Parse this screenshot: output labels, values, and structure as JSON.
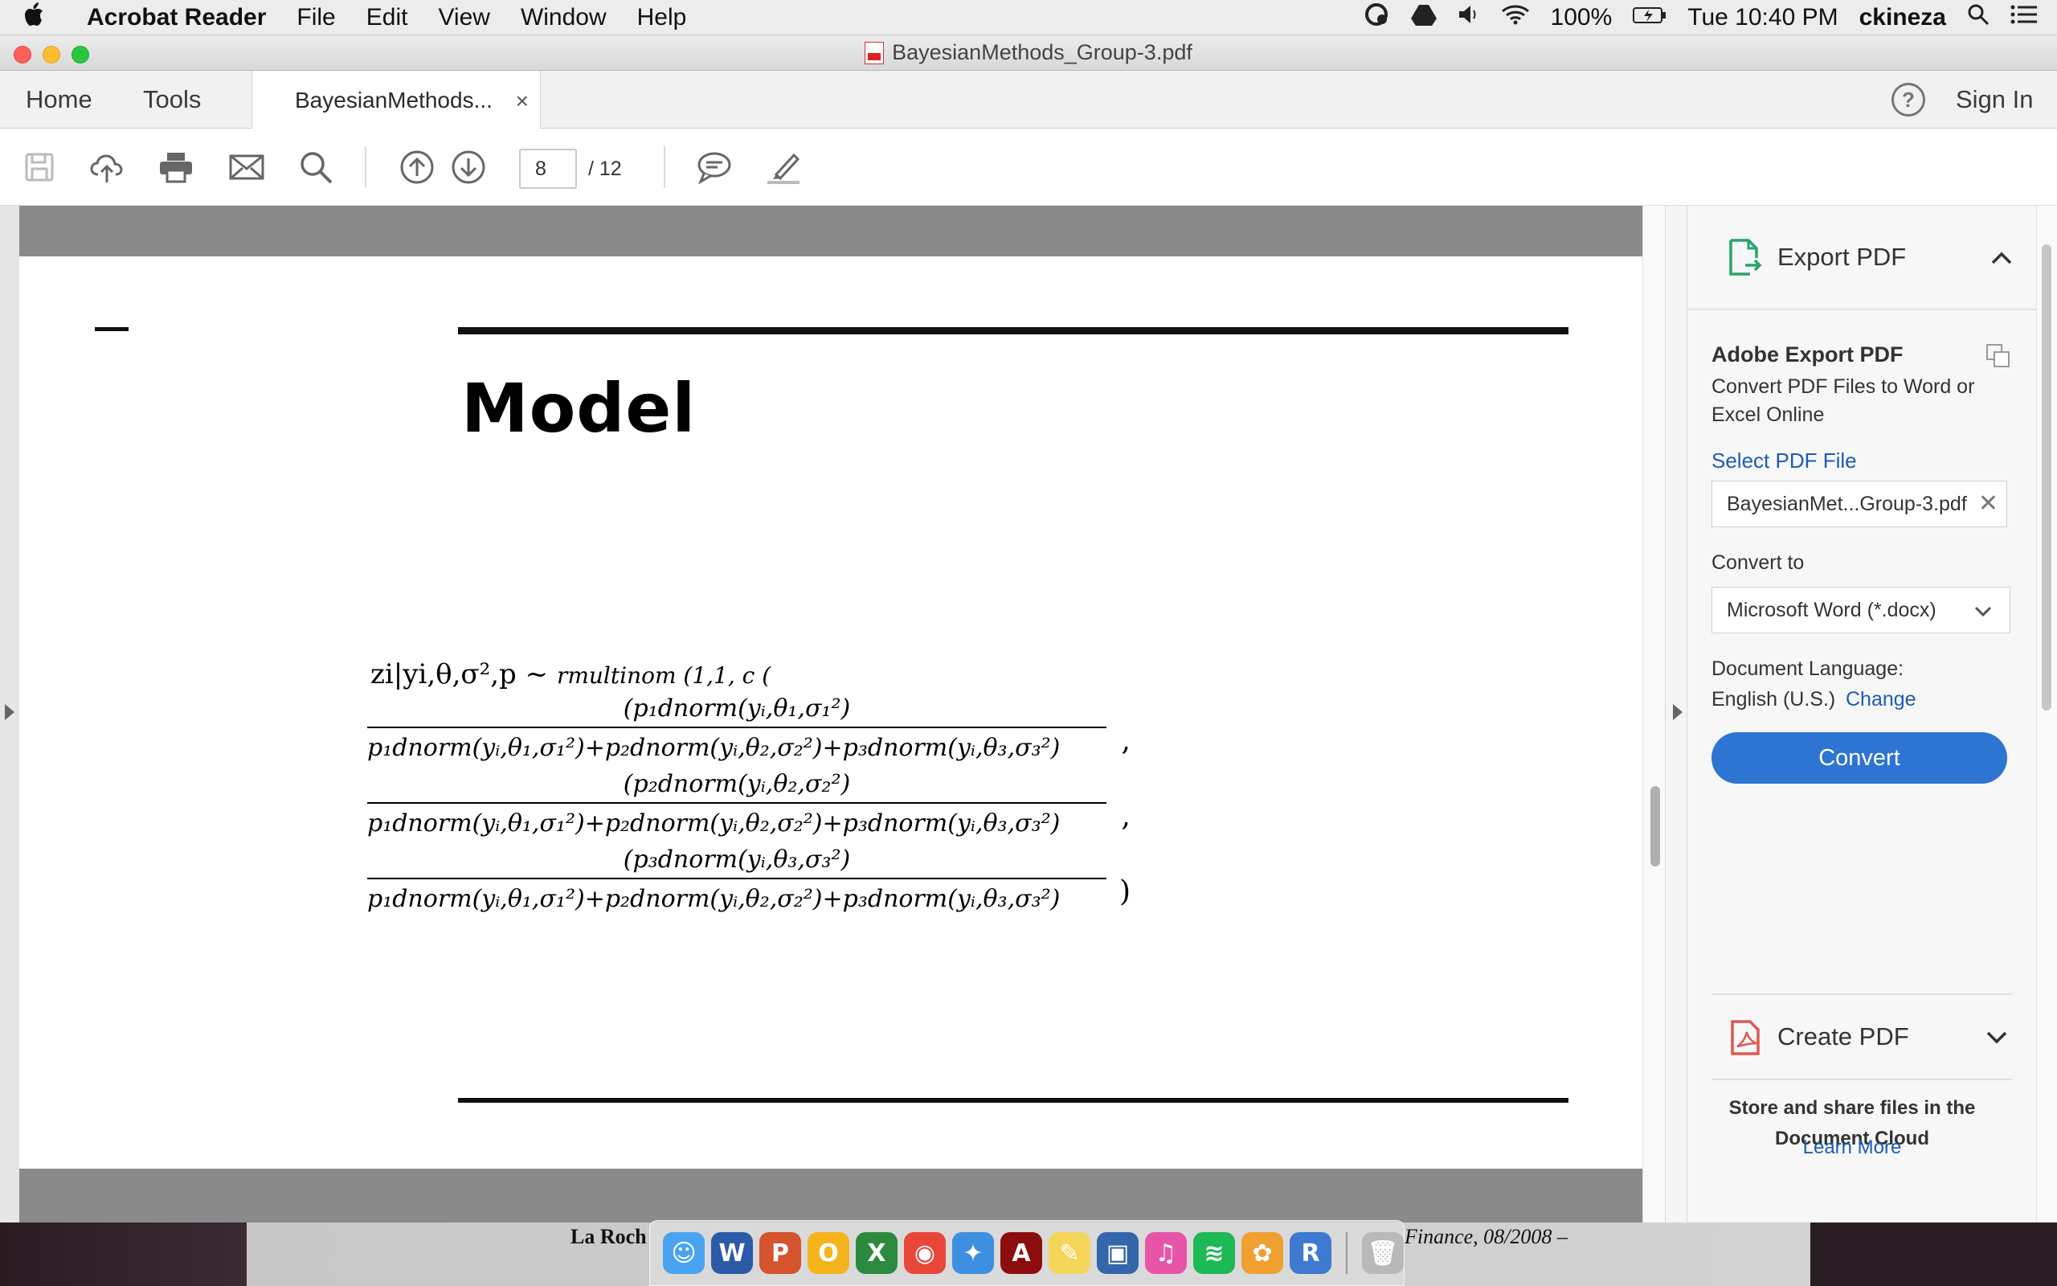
{
  "menubar": {
    "app_name": "Acrobat Reader",
    "menus": [
      "File",
      "Edit",
      "View",
      "Window",
      "Help"
    ],
    "battery": "100%",
    "clock": "Tue 10:40 PM",
    "user": "ckineza"
  },
  "window": {
    "title": "BayesianMethods_Group-3.pdf"
  },
  "tabs": {
    "home": "Home",
    "tools": "Tools",
    "document": "BayesianMethods...",
    "close": "×",
    "help": "?",
    "sign_in": "Sign In"
  },
  "toolbar": {
    "current_page": "8",
    "total_pages": "/  12",
    "icons": [
      "save-icon",
      "upload-cloud-icon",
      "print-icon",
      "mail-icon",
      "search-icon",
      "page-up-icon",
      "page-down-icon",
      "comment-icon",
      "highlight-pen-icon"
    ]
  },
  "document": {
    "page_title": "Model",
    "equation": {
      "head": "zi|yi,θ,σ²,p ~",
      "head_small": "rmultinom (1,1, c (",
      "fractions": [
        {
          "num": "(p₁dnorm(yᵢ,θ₁,σ₁²)",
          "den": "p₁dnorm(yᵢ,θ₁,σ₁²)+p₂dnorm(yᵢ,θ₂,σ₂²)+p₃dnorm(yᵢ,θ₃,σ₃²)",
          "tail": ","
        },
        {
          "num": "(p₂dnorm(yᵢ,θ₂,σ₂²)",
          "den": "p₁dnorm(yᵢ,θ₁,σ₁²)+p₂dnorm(yᵢ,θ₂,σ₂²)+p₃dnorm(yᵢ,θ₃,σ₃²)",
          "tail": ","
        },
        {
          "num": "(p₃dnorm(yᵢ,θ₃,σ₃²)",
          "den": "p₁dnorm(yᵢ,θ₁,σ₁²)+p₂dnorm(yᵢ,θ₂,σ₂²)+p₃dnorm(yᵢ,θ₃,σ₃²)",
          "tail": ")"
        }
      ]
    }
  },
  "panel": {
    "export_header": "Export PDF",
    "export_title": "Adobe Export PDF",
    "export_desc": "Convert PDF Files to Word or Excel Online",
    "select_link": "Select PDF File",
    "file_name": "BayesianMet...Group-3.pdf",
    "convert_to_label": "Convert to",
    "format": "Microsoft Word (*.docx)",
    "lang_label": "Document Language:",
    "lang_value": "English (U.S.)",
    "lang_change": "Change",
    "convert_button": "Convert",
    "create_header": "Create PDF",
    "cloud_text": "Store and share files in the Document Cloud",
    "learn_more": "Learn More"
  },
  "background": {
    "left_text": "La Roch",
    "right_text": "Finance, 08/2008 –"
  },
  "colors": {
    "accent": "#2d74d3",
    "link": "#1a5cb8",
    "export_icon": "#27a56a",
    "create_icon": "#e0574f"
  }
}
